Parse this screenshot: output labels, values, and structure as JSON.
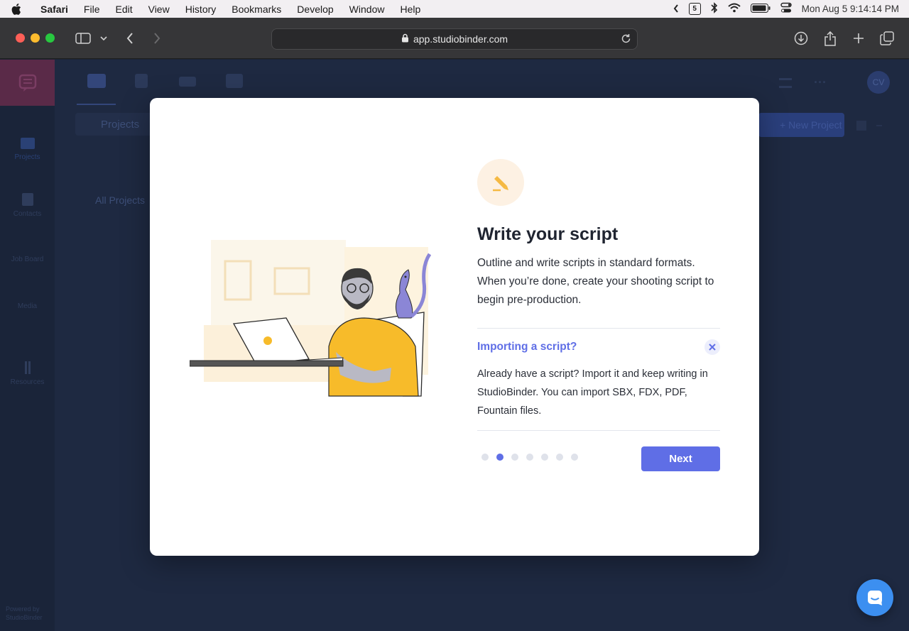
{
  "menubar": {
    "app_name": "Safari",
    "items": [
      "File",
      "Edit",
      "View",
      "History",
      "Bookmarks",
      "Develop",
      "Window",
      "Help"
    ],
    "calendar_badge": "5",
    "clock": "Mon Aug 5  9:14:14 PM"
  },
  "browser": {
    "url": "app.studiobinder.com"
  },
  "app": {
    "sidebar": {
      "items": [
        "Projects",
        "Contacts",
        "Job Board",
        "Media",
        "Resources"
      ],
      "powered_by": "Powered by StudioBinder"
    },
    "projects_label": "Projects",
    "all_projects_label": "All Projects",
    "new_project_label": "+ New Project",
    "avatar_initials": "CV"
  },
  "modal": {
    "title": "Write your script",
    "description": "Outline and write scripts in standard formats. When you’re done, create your shooting script to begin pre-production.",
    "import_title": "Importing a script?",
    "import_description": "Already have a script? Import it and keep writing in StudioBinder. You can import SBX, FDX, PDF, Fountain files.",
    "next_label": "Next",
    "pagination": {
      "total": 7,
      "current": 2
    }
  },
  "colors": {
    "accent": "#5f6ee6",
    "icon_bg": "#fdf1e3",
    "icon_accent": "#f5b943",
    "chat": "#3c8ff0"
  },
  "icons": {
    "feature": "pencil-icon",
    "close": "close-icon",
    "chat": "chat-icon"
  }
}
